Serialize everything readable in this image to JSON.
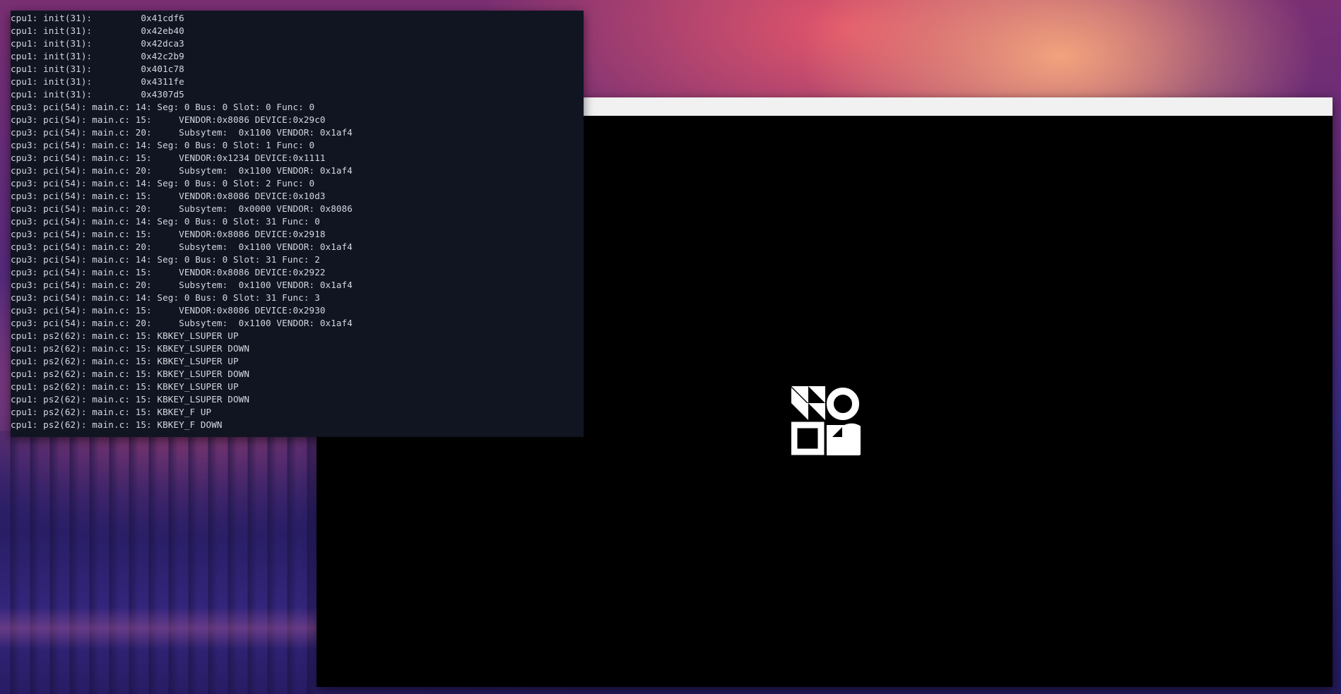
{
  "terminal": {
    "lines": [
      "cpu1: init(31):         0x41cdf6",
      "cpu1: init(31):         0x42eb40",
      "cpu1: init(31):         0x42dca3",
      "cpu1: init(31):         0x42c2b9",
      "cpu1: init(31):         0x401c78",
      "cpu1: init(31):         0x4311fe",
      "cpu1: init(31):         0x4307d5",
      "cpu3: pci(54): main.c: 14: Seg: 0 Bus: 0 Slot: 0 Func: 0",
      "cpu3: pci(54): main.c: 15:     VENDOR:0x8086 DEVICE:0x29c0",
      "cpu3: pci(54): main.c: 20:     Subsytem:  0x1100 VENDOR: 0x1af4",
      "cpu3: pci(54): main.c: 14: Seg: 0 Bus: 0 Slot: 1 Func: 0",
      "cpu3: pci(54): main.c: 15:     VENDOR:0x1234 DEVICE:0x1111",
      "cpu3: pci(54): main.c: 20:     Subsytem:  0x1100 VENDOR: 0x1af4",
      "cpu3: pci(54): main.c: 14: Seg: 0 Bus: 0 Slot: 2 Func: 0",
      "cpu3: pci(54): main.c: 15:     VENDOR:0x8086 DEVICE:0x10d3",
      "cpu3: pci(54): main.c: 20:     Subsytem:  0x0000 VENDOR: 0x8086",
      "cpu3: pci(54): main.c: 14: Seg: 0 Bus: 0 Slot: 31 Func: 0",
      "cpu3: pci(54): main.c: 15:     VENDOR:0x8086 DEVICE:0x2918",
      "cpu3: pci(54): main.c: 20:     Subsytem:  0x1100 VENDOR: 0x1af4",
      "cpu3: pci(54): main.c: 14: Seg: 0 Bus: 0 Slot: 31 Func: 2",
      "cpu3: pci(54): main.c: 15:     VENDOR:0x8086 DEVICE:0x2922",
      "cpu3: pci(54): main.c: 20:     Subsytem:  0x1100 VENDOR: 0x1af4",
      "cpu3: pci(54): main.c: 14: Seg: 0 Bus: 0 Slot: 31 Func: 3",
      "cpu3: pci(54): main.c: 15:     VENDOR:0x8086 DEVICE:0x2930",
      "cpu3: pci(54): main.c: 20:     Subsytem:  0x1100 VENDOR: 0x1af4",
      "cpu1: ps2(62): main.c: 15: KBKEY_LSUPER UP",
      "cpu1: ps2(62): main.c: 15: KBKEY_LSUPER DOWN",
      "cpu1: ps2(62): main.c: 15: KBKEY_LSUPER UP",
      "cpu1: ps2(62): main.c: 15: KBKEY_LSUPER DOWN",
      "cpu1: ps2(62): main.c: 15: KBKEY_LSUPER UP",
      "cpu1: ps2(62): main.c: 15: KBKEY_LSUPER DOWN",
      "cpu1: ps2(62): main.c: 15: KBKEY_F UP",
      "cpu1: ps2(62): main.c: 15: KBKEY_F DOWN"
    ]
  },
  "app_window": {
    "logo_icon": "geometric-shapes-logo-icon"
  },
  "colors": {
    "terminal_bg": "#111522",
    "terminal_fg": "#d4d7de",
    "app_bg": "#000000",
    "titlebar_bg": "#f1f1f1"
  }
}
